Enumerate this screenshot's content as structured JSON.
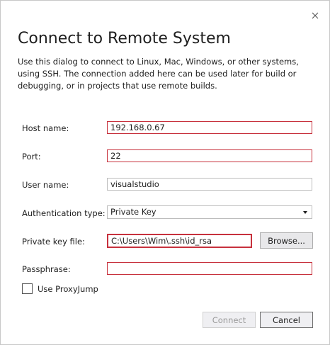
{
  "dialog": {
    "title": "Connect to Remote System",
    "description": "Use this dialog to connect to Linux, Mac, Windows, or other systems, using SSH. The connection added here can be used later for build or debugging, or in projects that use remote builds."
  },
  "form": {
    "host_label": "Host name:",
    "host_value": "192.168.0.67",
    "port_label": "Port:",
    "port_value": "22",
    "user_label": "User name:",
    "user_value": "visualstudio",
    "auth_label": "Authentication type:",
    "auth_value": "Private Key",
    "keyfile_label": "Private key file:",
    "keyfile_value": "C:\\Users\\Wim\\.ssh\\id_rsa",
    "browse_label": "Browse...",
    "passphrase_label": "Passphrase:",
    "passphrase_value": "",
    "proxyjump_label": "Use ProxyJump"
  },
  "buttons": {
    "connect_label": "Connect",
    "cancel_label": "Cancel"
  },
  "colors": {
    "error_border": "#c7313d"
  }
}
